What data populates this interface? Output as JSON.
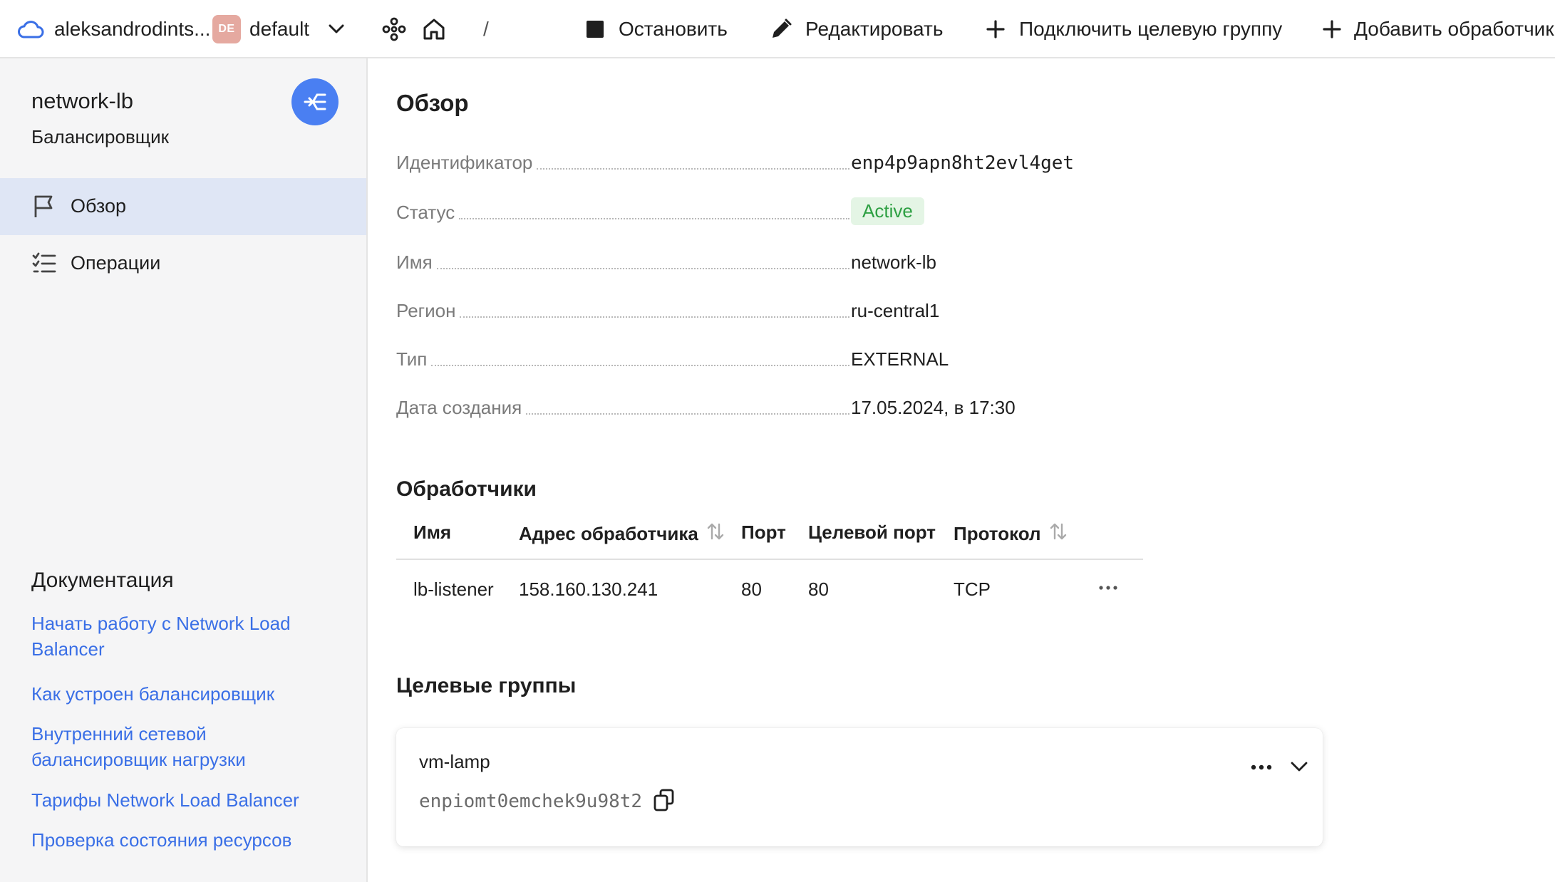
{
  "topbar": {
    "cloud_name": "aleksandrodints...",
    "folder_badge": "DE",
    "folder_name": "default",
    "breadcrumb_sep": "/",
    "actions": {
      "stop": "Остановить",
      "edit": "Редактировать",
      "attach_group": "Подключить целевую группу",
      "add_listener": "Добавить обработчик"
    }
  },
  "sidebar": {
    "title": "network-lb",
    "subtitle": "Балансировщик",
    "nav": [
      {
        "label": "Обзор",
        "icon": "flag-icon",
        "active": true
      },
      {
        "label": "Операции",
        "icon": "list-icon",
        "active": false
      }
    ],
    "docs_title": "Документация",
    "docs": [
      "Начать работу с Network Load Balancer",
      "Как устроен балансировщик",
      "Внутренний сетевой балансировщик нагрузки",
      "Тарифы Network Load Balancer",
      "Проверка состояния ресурсов"
    ]
  },
  "overview": {
    "title": "Обзор",
    "props": [
      {
        "key": "Идентификатор",
        "value": "enp4p9apn8ht2evl4get",
        "mono": true
      },
      {
        "key": "Статус",
        "value": "Active",
        "badge": true
      },
      {
        "key": "Имя",
        "value": "network-lb"
      },
      {
        "key": "Регион",
        "value": "ru-central1"
      },
      {
        "key": "Тип",
        "value": "EXTERNAL"
      },
      {
        "key": "Дата создания",
        "value": "17.05.2024, в 17:30"
      }
    ]
  },
  "listeners": {
    "title": "Обработчики",
    "headers": [
      "Имя",
      "Адрес обработчика",
      "Порт",
      "Целевой порт",
      "Протокол"
    ],
    "rows": [
      [
        "lb-listener",
        "158.160.130.241",
        "80",
        "80",
        "TCP"
      ]
    ]
  },
  "target_groups": {
    "title": "Целевые группы",
    "items": [
      {
        "name": "vm-lamp",
        "id": "enpiomt0emchek9u98t2"
      }
    ]
  },
  "colors": {
    "accent": "#3a6fe6",
    "avatar": "#4a7ff2",
    "status_active_bg": "#e4f5e5",
    "status_active_fg": "#2ea043",
    "nav_active_bg": "#dfe6f5"
  }
}
